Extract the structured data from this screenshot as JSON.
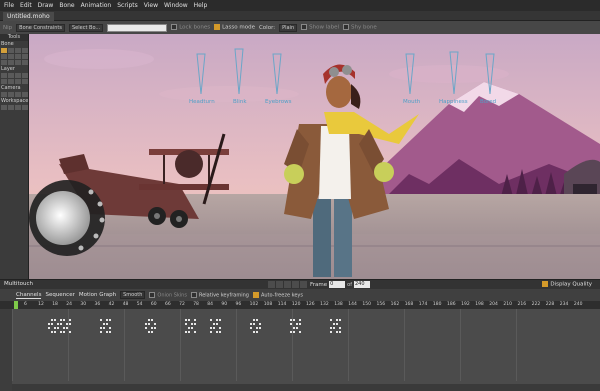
{
  "menu": [
    "File",
    "Edit",
    "Draw",
    "Bone",
    "Animation",
    "Scripts",
    "View",
    "Window",
    "Help"
  ],
  "document_tab": "Untitled.moho",
  "tool_options": {
    "nip": "Nip",
    "bone_constraints": "Bone Constraints",
    "select_bone": "Select Bo...",
    "lock_bones": "Lock bones",
    "lasso_mode": "Lasso mode",
    "color_label": "Color:",
    "color_value": "Plain",
    "show_label": "Show label",
    "shy_bone": "Shy bone"
  },
  "tools_panel": {
    "header": "Tools",
    "groups": [
      "Bone",
      "Layer",
      "Camera",
      "Workspace"
    ]
  },
  "canvas": {
    "controls": [
      "Headturn",
      "Blink",
      "Eyebrows",
      "Mouth",
      "Happiness",
      "Bored"
    ]
  },
  "multitouch": {
    "label": "Multitouch",
    "frame_label": "Frame",
    "frame_value": "0",
    "of_label": "of",
    "end_value": "240",
    "display_quality": "Display Quality"
  },
  "timeline": {
    "tabs": [
      "Channels",
      "Sequencer",
      "Motion Graph"
    ],
    "interpolation": "Smooth",
    "onion_skins": "Onion Skins",
    "relative_keyframing": "Relative keyframing",
    "auto_freeze": "Auto-freeze keys",
    "ruler_labels": [
      "6",
      "12",
      "18",
      "24",
      "30",
      "36",
      "42",
      "48",
      "54",
      "60",
      "66",
      "72",
      "78",
      "84",
      "90",
      "96",
      "102",
      "108",
      "114",
      "120",
      "126",
      "132",
      "138",
      "144",
      "150",
      "156",
      "162",
      "168",
      "174",
      "180",
      "186",
      "192",
      "198",
      "204",
      "210",
      "216",
      "222",
      "228",
      "234",
      "240"
    ]
  },
  "colors": {
    "accent": "#d49a2a",
    "playhead": "#7fc94a",
    "sky_top": "#c9a9c5",
    "sky_bottom": "#f0c9b2"
  }
}
